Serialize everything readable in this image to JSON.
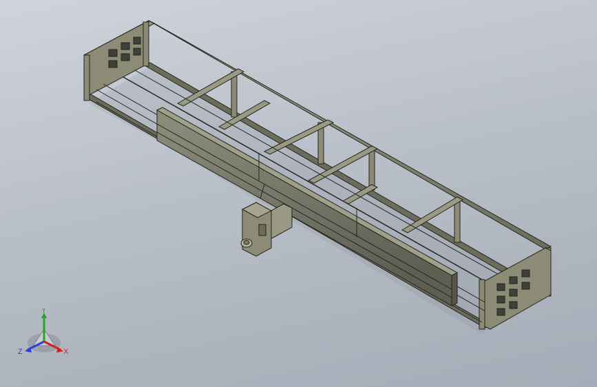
{
  "viewport": {
    "background_top": "#cfd4db",
    "background_bottom": "#a6acb7"
  },
  "model": {
    "frame_color": "#8c8c76",
    "frame_dark": "#55554a",
    "edge_color": "#24241e",
    "rail_color": "#77776a"
  },
  "triad": {
    "axes": [
      {
        "label": "Y",
        "color": "#2ba32b"
      },
      {
        "label": "Z",
        "color": "#2f3fd2"
      },
      {
        "label": "X",
        "color": "#d32121"
      }
    ]
  }
}
